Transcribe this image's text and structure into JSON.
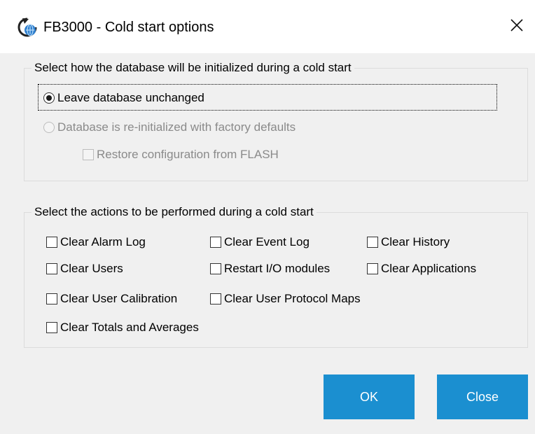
{
  "window": {
    "title": "FB3000 - Cold start options",
    "app_icon": "cold-start-app-icon",
    "close_icon": "close-icon"
  },
  "db_init": {
    "legend": "Select how the database will be initialized during a cold start",
    "options": [
      {
        "label": "Leave database unchanged",
        "selected": true,
        "enabled": true
      },
      {
        "label": "Database is re-initialized with factory defaults",
        "selected": false,
        "enabled": false
      }
    ],
    "restore_flash": {
      "label": "Restore configuration from FLASH",
      "checked": false,
      "enabled": false
    }
  },
  "actions": {
    "legend": "Select the actions to be performed during  a cold start",
    "items": [
      {
        "label": "Clear Alarm Log",
        "checked": false
      },
      {
        "label": "Clear Event Log",
        "checked": false
      },
      {
        "label": "Clear History",
        "checked": false
      },
      {
        "label": "Clear Users",
        "checked": false
      },
      {
        "label": "Restart I/O modules",
        "checked": false
      },
      {
        "label": "Clear Applications",
        "checked": false
      },
      {
        "label": "Clear User Calibration",
        "checked": false
      },
      {
        "label": "Clear User Protocol Maps",
        "checked": false
      },
      {
        "label": "Clear Totals and Averages",
        "checked": false
      }
    ]
  },
  "buttons": {
    "ok_label": "OK",
    "close_label": "Close"
  },
  "colors": {
    "button_blue": "#1b8fd0",
    "dialog_bg": "#f0f0f0",
    "disabled_text": "#8a8a8a"
  }
}
